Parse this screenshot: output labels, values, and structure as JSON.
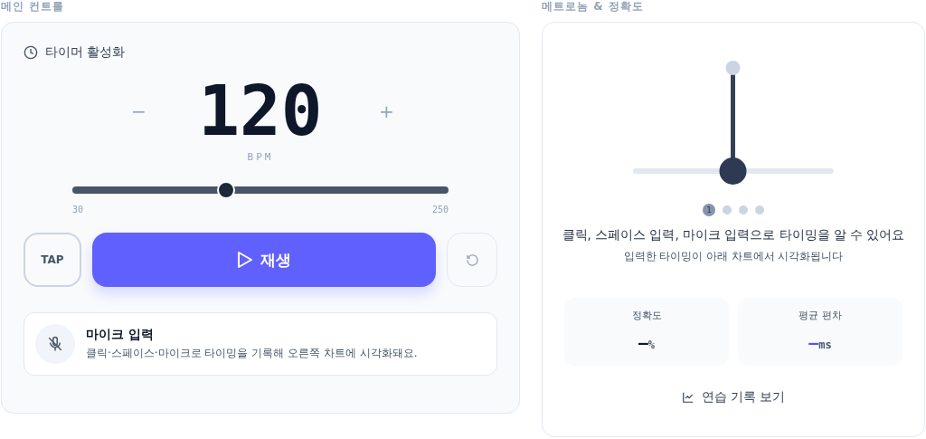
{
  "main": {
    "section_title": "메인 컨트롤",
    "timer_label": "타이머 활성화",
    "decrement": "−",
    "bpm": "120",
    "increment": "+",
    "unit": "BPM",
    "tempo": {
      "level": 0.409,
      "min": "30",
      "max": "250"
    },
    "tap": "TAP",
    "play": "재생",
    "mic": {
      "title": "마이크 입력",
      "description": "클릭·스페이스·마이크로 타이밍을 기록해 오른쪽 차트에 시각화돼요.",
      "on": false
    }
  },
  "metronome": {
    "section_title": "메트로놈 & 정확도",
    "pages": [
      {
        "label": "1",
        "selected": true
      },
      {
        "selected": false
      },
      {
        "selected": false
      },
      {
        "selected": false
      }
    ],
    "headline": "클릭, 스페이스 입력, 마이크 입력으로 타이밍을 알 수 있어요",
    "subtitle": "입력한 타이밍이 아래 차트에서 시각화됩니다",
    "stats": [
      {
        "label": "정확도",
        "value": "—",
        "unit": "%",
        "color": "#0f172a"
      },
      {
        "label": "평균 편차",
        "value": "—",
        "unit": "ms",
        "color": "#5b4bff"
      }
    ],
    "history_link": "연습 기록 보기"
  }
}
